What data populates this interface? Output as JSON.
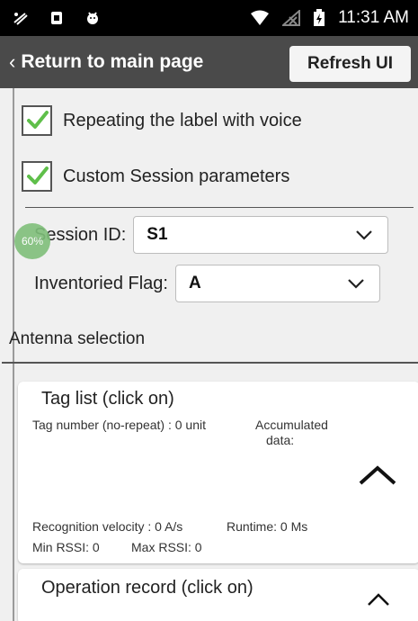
{
  "status_bar": {
    "time": "11:31 AM"
  },
  "header": {
    "back_label": "Return to main page",
    "refresh_label": "Refresh UI"
  },
  "options": {
    "repeat_voice": {
      "label": "Repeating the label with voice",
      "checked": true
    },
    "custom_session": {
      "label": "Custom Session parameters",
      "checked": true
    }
  },
  "session": {
    "label": "Session ID:",
    "value": "S1"
  },
  "inventoried_flag": {
    "label": "Inventoried Flag:",
    "value": "A"
  },
  "badge": "60%",
  "antenna": {
    "label": "Antenna selection"
  },
  "tag_list": {
    "title": "Tag list (click on)",
    "tag_number": "Tag number (no-repeat) : 0 unit",
    "accumulated_line1": "Accumulated",
    "accumulated_line2": "data:",
    "recognition_velocity": "Recognition velocity : 0 A/s",
    "runtime": "Runtime: 0 Ms",
    "min_rssi": "Min RSSI: 0",
    "max_rssi": "Max RSSI: 0"
  },
  "operation_record": {
    "title": "Operation record (click on)"
  },
  "colors": {
    "header_bg": "#4a4a4a",
    "check_green": "#5fbf4a"
  }
}
